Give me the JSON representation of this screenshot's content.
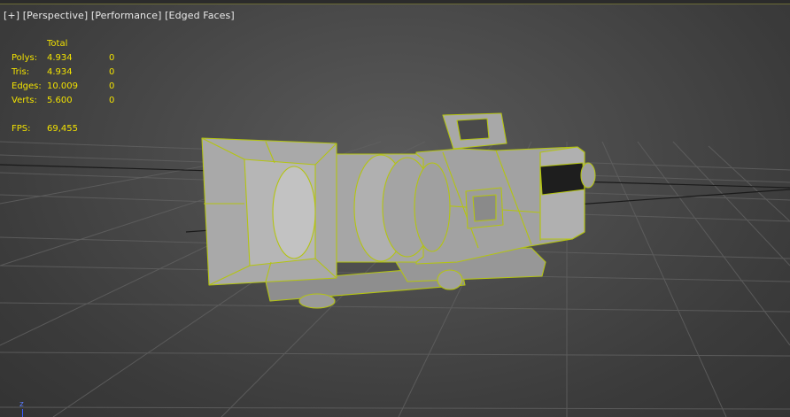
{
  "viewport": {
    "menus": {
      "plus": "[+]",
      "view": "[Perspective]",
      "shading": "[Performance]",
      "edges": "[Edged Faces]"
    },
    "stats": {
      "header": "Total",
      "rows": [
        {
          "label": "Polys:",
          "total": "4.934",
          "sel": "0"
        },
        {
          "label": "Tris:",
          "total": "4.934",
          "sel": "0"
        },
        {
          "label": "Edges:",
          "total": "10.009",
          "sel": "0"
        },
        {
          "label": "Verts:",
          "total": "5.600",
          "sel": "0"
        }
      ],
      "fps_label": "FPS:",
      "fps_value": "69,455"
    },
    "axis_label": "z"
  },
  "colors": {
    "wire": "#b8c614",
    "stats_text": "#f2e200",
    "model_fill": "#9a9a9a",
    "grid": "#5c5c5c",
    "axis_x": "#111111"
  },
  "model": {
    "type": "camera-wireframe"
  }
}
